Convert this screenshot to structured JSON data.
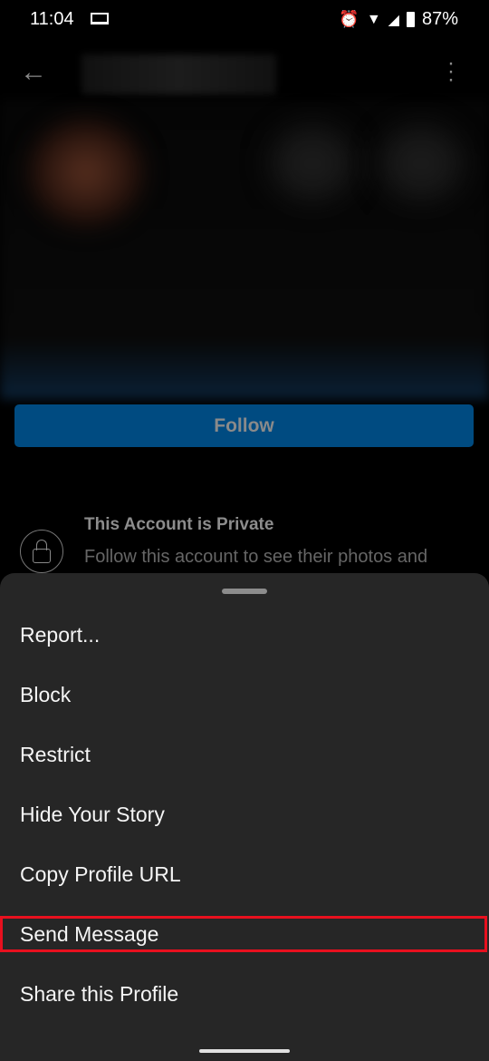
{
  "status_bar": {
    "time": "11:04",
    "battery": "87%",
    "icons": [
      "laptop-icon",
      "alarm-icon",
      "wifi-icon",
      "signal-icon",
      "battery-icon"
    ]
  },
  "app_bar": {
    "back_icon": "arrow-left-icon",
    "more_icon": "more-vertical-icon"
  },
  "profile": {
    "follow_label": "Follow",
    "private_title": "This Account is Private",
    "private_desc": "Follow this account to see their photos and",
    "accent": "#004b81"
  },
  "sheet": {
    "items": [
      {
        "label": "Report..."
      },
      {
        "label": "Block"
      },
      {
        "label": "Restrict"
      },
      {
        "label": "Hide Your Story"
      },
      {
        "label": "Copy Profile URL"
      },
      {
        "label": "Send Message",
        "highlighted": true
      },
      {
        "label": "Share this Profile"
      }
    ],
    "highlight_color": "#e8101e"
  }
}
